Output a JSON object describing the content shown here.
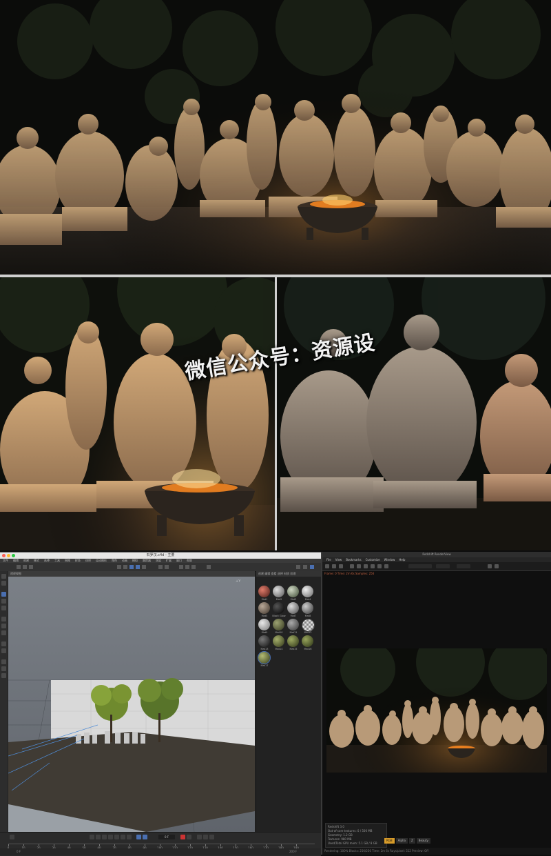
{
  "watermark": {
    "text": "微信公众号：资源设"
  },
  "c4d": {
    "title": "石罗汉.c4d - 主要",
    "menu": [
      "文件",
      "编辑",
      "创建",
      "模式",
      "选择",
      "工具",
      "网格",
      "样条",
      "体积",
      "运动图形",
      "角色",
      "动画",
      "模拟",
      "跟踪器",
      "渲染",
      "扩展",
      "窗口",
      "帮助"
    ],
    "viewport_header": "透视视图",
    "material_panel_header": "创建 编辑 查看 选择 材质 纹理",
    "materials": [
      "Mat1",
      "Mat2",
      "Mat3",
      "Mat4",
      "Mat5",
      "Black Glow",
      "Mat7",
      "Mat8",
      "Mat9",
      "Mat10",
      "Mat11",
      "Mat12",
      "Mat13",
      "Mat14",
      "Mat15",
      "Mat16",
      "Mat17",
      "Mat18",
      "Mat19",
      "Mat20",
      "Mat21"
    ],
    "timeline_ticks": [
      "0",
      "10",
      "20",
      "30",
      "40",
      "50",
      "60",
      "70",
      "80",
      "90",
      "100",
      "110",
      "120",
      "130",
      "140",
      "150",
      "160",
      "170",
      "180",
      "190"
    ],
    "frame_current": "0 F",
    "frame_end": "200 F"
  },
  "rs": {
    "title": "Redshift RenderView",
    "menu": [
      "File",
      "View",
      "Bookmarks",
      "Customize",
      "Window",
      "Help"
    ],
    "info_line": "Frame: 0  Time: 2m 6s  Samples: 256",
    "stats": [
      "Redshift 3.0",
      "Out-of-core textures: 0 / 500 MB",
      "Geometry: 1.2 GB",
      "Textures: 980 MB",
      "Used/Total GPU mem: 5.1 GB / 8 GB"
    ],
    "tabs": [
      "RGB",
      "Alpha",
      "Z",
      "Beauty"
    ],
    "bottom_line": "Rendering: 100%   Blocks: 256/256   Time: 2m 6s   Rays/pixel: 512   Preview: Off"
  }
}
